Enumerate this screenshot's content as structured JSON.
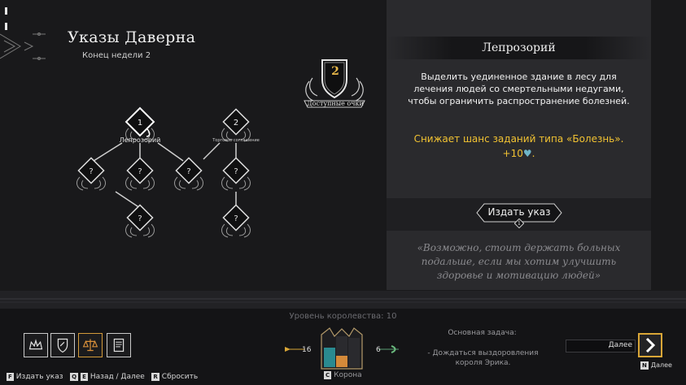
{
  "header": {
    "title": "Указы Даверна",
    "subtitle": "Конец недели 2"
  },
  "points": {
    "value": "2",
    "label": "Доступные очки"
  },
  "tree": {
    "node1_cost": "1",
    "node1_label": "Лепрозорий",
    "node2_cost": "2",
    "node2_label": "Торговое соглашение",
    "locked_symbol": "?"
  },
  "panel": {
    "title": "Лепрозорий",
    "description": "Выделить уединенное здание в лесу для лечения людей со смертельными недугами, чтобы ограничить распространение болезней.",
    "effect": "Снижает шанс заданий типа «Болезнь».",
    "effect_value": "+10",
    "heart_icon": "♥",
    "effect_end": ".",
    "issue_label": "Издать указ",
    "issue_cost": "1",
    "quote": "«Возможно, стоит держать больных подальше, если мы хотим улучшить здоровье и мотивацию людей»"
  },
  "bottom": {
    "kingdom_level": "Уровень королевства: 10",
    "crown_left_value": "16",
    "crown_right_value": "6",
    "crown_key": "C",
    "crown_label": "Корона",
    "task_label": "Основная задача:",
    "task_text": "- Дождаться выздоровления короля Эрика.",
    "next_label": "Далее",
    "next_key": "N",
    "next_caption": "Далее",
    "hints": {
      "issue_key": "F",
      "issue": "Издать указ",
      "q_key": "Q",
      "e_key": "E",
      "back_next": "Назад / Далее",
      "r_key": "R",
      "reset": "Сбросить"
    }
  },
  "colors": {
    "accent_gold": "#f1c232",
    "panel_bg": "#2a2a2d",
    "heart": "#6fb6c9",
    "next_border": "#d9a637"
  }
}
